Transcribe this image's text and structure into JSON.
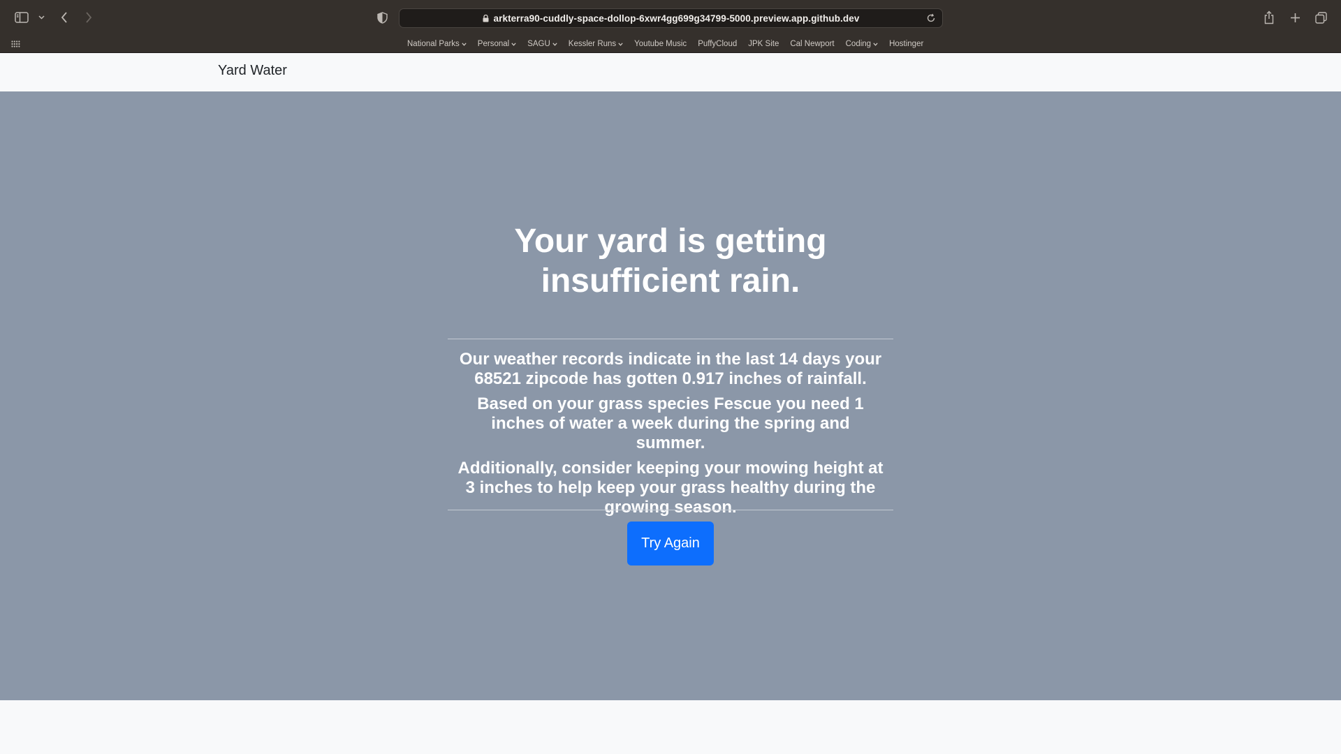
{
  "browser": {
    "url": "arkterra90-cuddly-space-dollop-6xwr4gg699g34799-5000.preview.app.github.dev",
    "bookmarks": [
      {
        "label": "National Parks",
        "folder": true
      },
      {
        "label": "Personal",
        "folder": true
      },
      {
        "label": "SAGU",
        "folder": true
      },
      {
        "label": "Kessler Runs",
        "folder": true
      },
      {
        "label": "Youtube Music",
        "folder": false
      },
      {
        "label": "PuffyCloud",
        "folder": false
      },
      {
        "label": "JPK Site",
        "folder": false
      },
      {
        "label": "Cal Newport",
        "folder": false
      },
      {
        "label": "Coding",
        "folder": true
      },
      {
        "label": "Hostinger",
        "folder": false
      }
    ],
    "icons": {
      "sidebar": "sidebar-icon",
      "back": "chevron-left-icon",
      "forward": "chevron-right-icon",
      "privacy": "shield-icon",
      "reload": "reload-icon",
      "share": "share-icon",
      "new_tab": "plus-icon",
      "tabs": "tab-overview-icon",
      "apps": "grid-icon"
    }
  },
  "navbar": {
    "brand": "Yard Water"
  },
  "hero": {
    "title": "Your yard is getting insufficient rain.",
    "paragraphs": [
      "Our weather records indicate in the last 14 days your 68521 zipcode has gotten 0.917 inches of rainfall.",
      "Based on your grass species Fescue you need 1 inches of water a week during the spring and summer.",
      "Additionally, consider keeping your mowing height at 3 inches to help keep your grass healthy during the growing season."
    ],
    "button": "Try Again"
  },
  "colors": {
    "chrome_bg": "#35302c",
    "hero_bg": "#8b97a8",
    "button_bg": "#0d6efd",
    "page_bg": "#f8f9fa"
  }
}
